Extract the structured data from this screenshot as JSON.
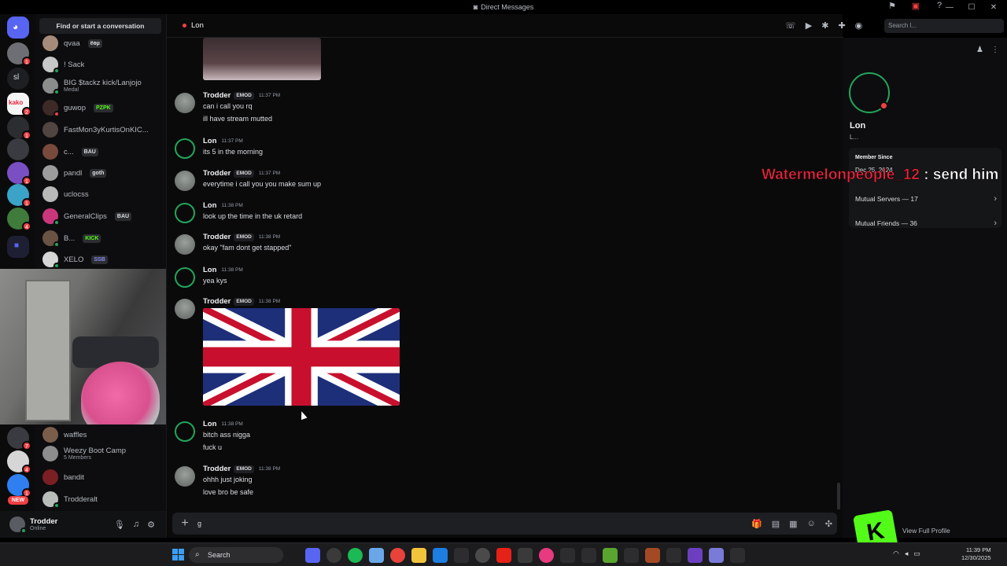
{
  "window": {
    "title": "Direct Messages"
  },
  "dm_list": {
    "search_placeholder": "Find or start a conversation",
    "items_top": [
      {
        "name": "qvaa",
        "tag": "ёөµ"
      },
      {
        "name": "! Sack",
        "tag": ""
      },
      {
        "name": "BIG $tackz kick/Lanjojo",
        "sub": "Medal"
      },
      {
        "name": "guwop",
        "tag": "PZPK"
      },
      {
        "name": "FastMon3yKurtisOnKIC...",
        "tag": ""
      },
      {
        "name": "c...",
        "tag": "BAU"
      },
      {
        "name": "pandl",
        "tag": "goth"
      },
      {
        "name": "uclocss",
        "tag": ""
      },
      {
        "name": "GeneralClips",
        "tag": "BAU"
      },
      {
        "name": "B...",
        "tag": "KICK"
      },
      {
        "name": "XELO",
        "tag": "SSB"
      }
    ],
    "items_bottom": [
      {
        "name": "waffles",
        "sub": ""
      },
      {
        "name": "Weezy Boot Camp",
        "sub": "5 Members"
      },
      {
        "name": "bandit",
        "sub": ""
      },
      {
        "name": "Trodderalt",
        "sub": ""
      }
    ]
  },
  "user_panel": {
    "name": "Trodder",
    "status": "Online"
  },
  "guilds": {
    "sl_label": "sl",
    "kako_label": "kako",
    "new_label": "NEW",
    "badges": [
      "1",
      "2",
      "1",
      "1",
      "1",
      "4",
      "7",
      "4",
      "1"
    ]
  },
  "chat": {
    "recipient": "Lon",
    "header_search_placeholder": "Search l...",
    "messages": [
      {
        "author": "Trodder",
        "tag": "EMOD",
        "time": "11:37 PM",
        "lines": [
          "can i call you rq",
          "ill have stream mutted"
        ]
      },
      {
        "author": "Lon",
        "tag": "",
        "time": "11:37 PM",
        "lines": [
          "its 5 in the morning"
        ]
      },
      {
        "author": "Trodder",
        "tag": "EMOD",
        "time": "11:37 PM",
        "lines": [
          "everytime i call you you make sum up"
        ]
      },
      {
        "author": "Lon",
        "tag": "",
        "time": "11:38 PM",
        "lines": [
          "look up the time in the uk retard"
        ]
      },
      {
        "author": "Trodder",
        "tag": "EMOD",
        "time": "11:38 PM",
        "lines": [
          "okay \"fam dont get stapped\""
        ]
      },
      {
        "author": "Lon",
        "tag": "",
        "time": "11:38 PM",
        "lines": [
          "yea kys"
        ]
      },
      {
        "author": "Trodder",
        "tag": "EMOD",
        "time": "11:38 PM",
        "lines": []
      },
      {
        "author": "Lon",
        "tag": "",
        "time": "11:38 PM",
        "lines": [
          "bitch ass nigga",
          "fuck u"
        ]
      },
      {
        "author": "Trodder",
        "tag": "EMOD",
        "time": "11:38 PM",
        "lines": [
          "ohhh just joking",
          "love bro be safe"
        ]
      }
    ],
    "composer_value": "g"
  },
  "profile": {
    "name": "Lon",
    "username": "L...",
    "member_since_label": "Member Since",
    "member_since_value": "Dec 25, 2024",
    "mutual_servers": "Mutual Servers — 17",
    "mutual_friends": "Mutual Friends — 36",
    "view_full": "View Full Profile"
  },
  "stream_overlay": {
    "user": "Watermelonpeople_12",
    "text": ": send him"
  },
  "taskbar": {
    "search_label": "Search",
    "time": "11:39 PM",
    "date": "12/30/2025"
  },
  "colors": {
    "accent": "#5865f2",
    "online": "#23a55a",
    "dnd": "#f23f43",
    "kick_green": "#53fc18",
    "overlay_red": "#e8243c"
  }
}
